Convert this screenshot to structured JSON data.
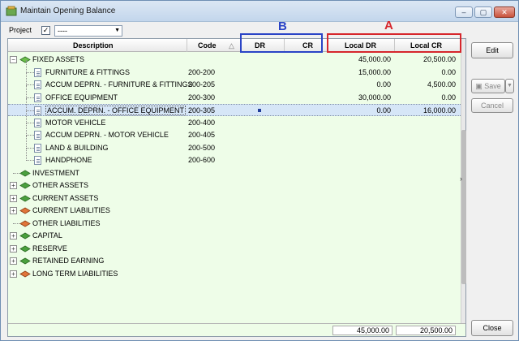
{
  "window": {
    "title": "Maintain Opening Balance",
    "min_label": "–",
    "max_label": "▢",
    "close_label": "✕"
  },
  "project": {
    "label": "Project",
    "checked_mark": "✓",
    "selected_value": "----"
  },
  "table": {
    "columns": {
      "description": "Description",
      "code": "Code",
      "sort_indicator": "△",
      "dr": "DR",
      "cr": "CR",
      "local_dr": "Local DR",
      "local_cr": "Local CR"
    },
    "rows": [
      {
        "description": "FIXED ASSETS",
        "code": "",
        "local_dr": "45,000.00",
        "local_cr": "20,500.00",
        "level": 0,
        "expander": "−",
        "icon": "fixed-assets-icon"
      },
      {
        "description": "FURNITURE & FITTINGS",
        "code": "200-200",
        "local_dr": "15,000.00",
        "local_cr": "0.00",
        "level": 1,
        "icon": "account-doc-icon"
      },
      {
        "description": "ACCUM DEPRN. - FURNITURE & FITTINGS",
        "code": "200-205",
        "local_dr": "0.00",
        "local_cr": "4,500.00",
        "level": 1,
        "icon": "account-doc-icon"
      },
      {
        "description": "OFFICE EQUIPMENT",
        "code": "200-300",
        "local_dr": "30,000.00",
        "local_cr": "0.00",
        "level": 1,
        "icon": "account-doc-icon"
      },
      {
        "description": "ACCUM. DEPRN. - OFFICE EQUIPMENT",
        "code": "200-305",
        "local_dr": "0.00",
        "local_cr": "16,000.00",
        "level": 1,
        "icon": "account-doc-icon",
        "selected": true
      },
      {
        "description": "MOTOR VEHICLE",
        "code": "200-400",
        "local_dr": "",
        "local_cr": "",
        "level": 1,
        "icon": "account-doc-icon"
      },
      {
        "description": "ACCUM DEPRN. - MOTOR VEHICLE",
        "code": "200-405",
        "local_dr": "",
        "local_cr": "",
        "level": 1,
        "icon": "account-doc-icon"
      },
      {
        "description": "LAND & BUILDING",
        "code": "200-500",
        "local_dr": "",
        "local_cr": "",
        "level": 1,
        "icon": "account-doc-icon"
      },
      {
        "description": "HANDPHONE",
        "code": "200-600",
        "local_dr": "",
        "local_cr": "",
        "level": 1,
        "icon": "account-doc-icon"
      },
      {
        "description": "INVESTMENT",
        "code": "",
        "local_dr": "",
        "local_cr": "",
        "level": 0,
        "icon": "green-group-icon"
      },
      {
        "description": "OTHER ASSETS",
        "code": "",
        "local_dr": "",
        "local_cr": "",
        "level": 0,
        "expander": "+",
        "icon": "green-group-icon"
      },
      {
        "description": "CURRENT ASSETS",
        "code": "",
        "local_dr": "",
        "local_cr": "",
        "level": 0,
        "expander": "+",
        "icon": "green-group-icon"
      },
      {
        "description": "CURRENT LIABILITIES",
        "code": "",
        "local_dr": "",
        "local_cr": "",
        "level": 0,
        "expander": "+",
        "icon": "orange-group-icon"
      },
      {
        "description": "OTHER LIABILITIES",
        "code": "",
        "local_dr": "",
        "local_cr": "",
        "level": 0,
        "icon": "orange-group-icon"
      },
      {
        "description": "CAPITAL",
        "code": "",
        "local_dr": "",
        "local_cr": "",
        "level": 0,
        "expander": "+",
        "icon": "green-group-icon"
      },
      {
        "description": "RESERVE",
        "code": "",
        "local_dr": "",
        "local_cr": "",
        "level": 0,
        "expander": "+",
        "icon": "green-group-icon"
      },
      {
        "description": "RETAINED EARNING",
        "code": "",
        "local_dr": "",
        "local_cr": "",
        "level": 0,
        "expander": "+",
        "icon": "green-group-icon"
      },
      {
        "description": "LONG TERM LIABILITIES",
        "code": "",
        "local_dr": "",
        "local_cr": "",
        "level": 0,
        "expander": "+",
        "icon": "orange-group-icon"
      }
    ],
    "totals": {
      "local_dr": "45,000.00",
      "local_cr": "20,500.00"
    }
  },
  "buttons": {
    "edit": "Edit",
    "save": "Save",
    "save_drop": "▼",
    "cancel": "Cancel",
    "close": "Close"
  },
  "annotations": {
    "a": "A",
    "b": "B"
  },
  "colors": {
    "grid_bg": "#eefde8",
    "annotation_a": "#d6262c",
    "annotation_b": "#2a44c6",
    "selected_row": "#d6e6f7"
  }
}
